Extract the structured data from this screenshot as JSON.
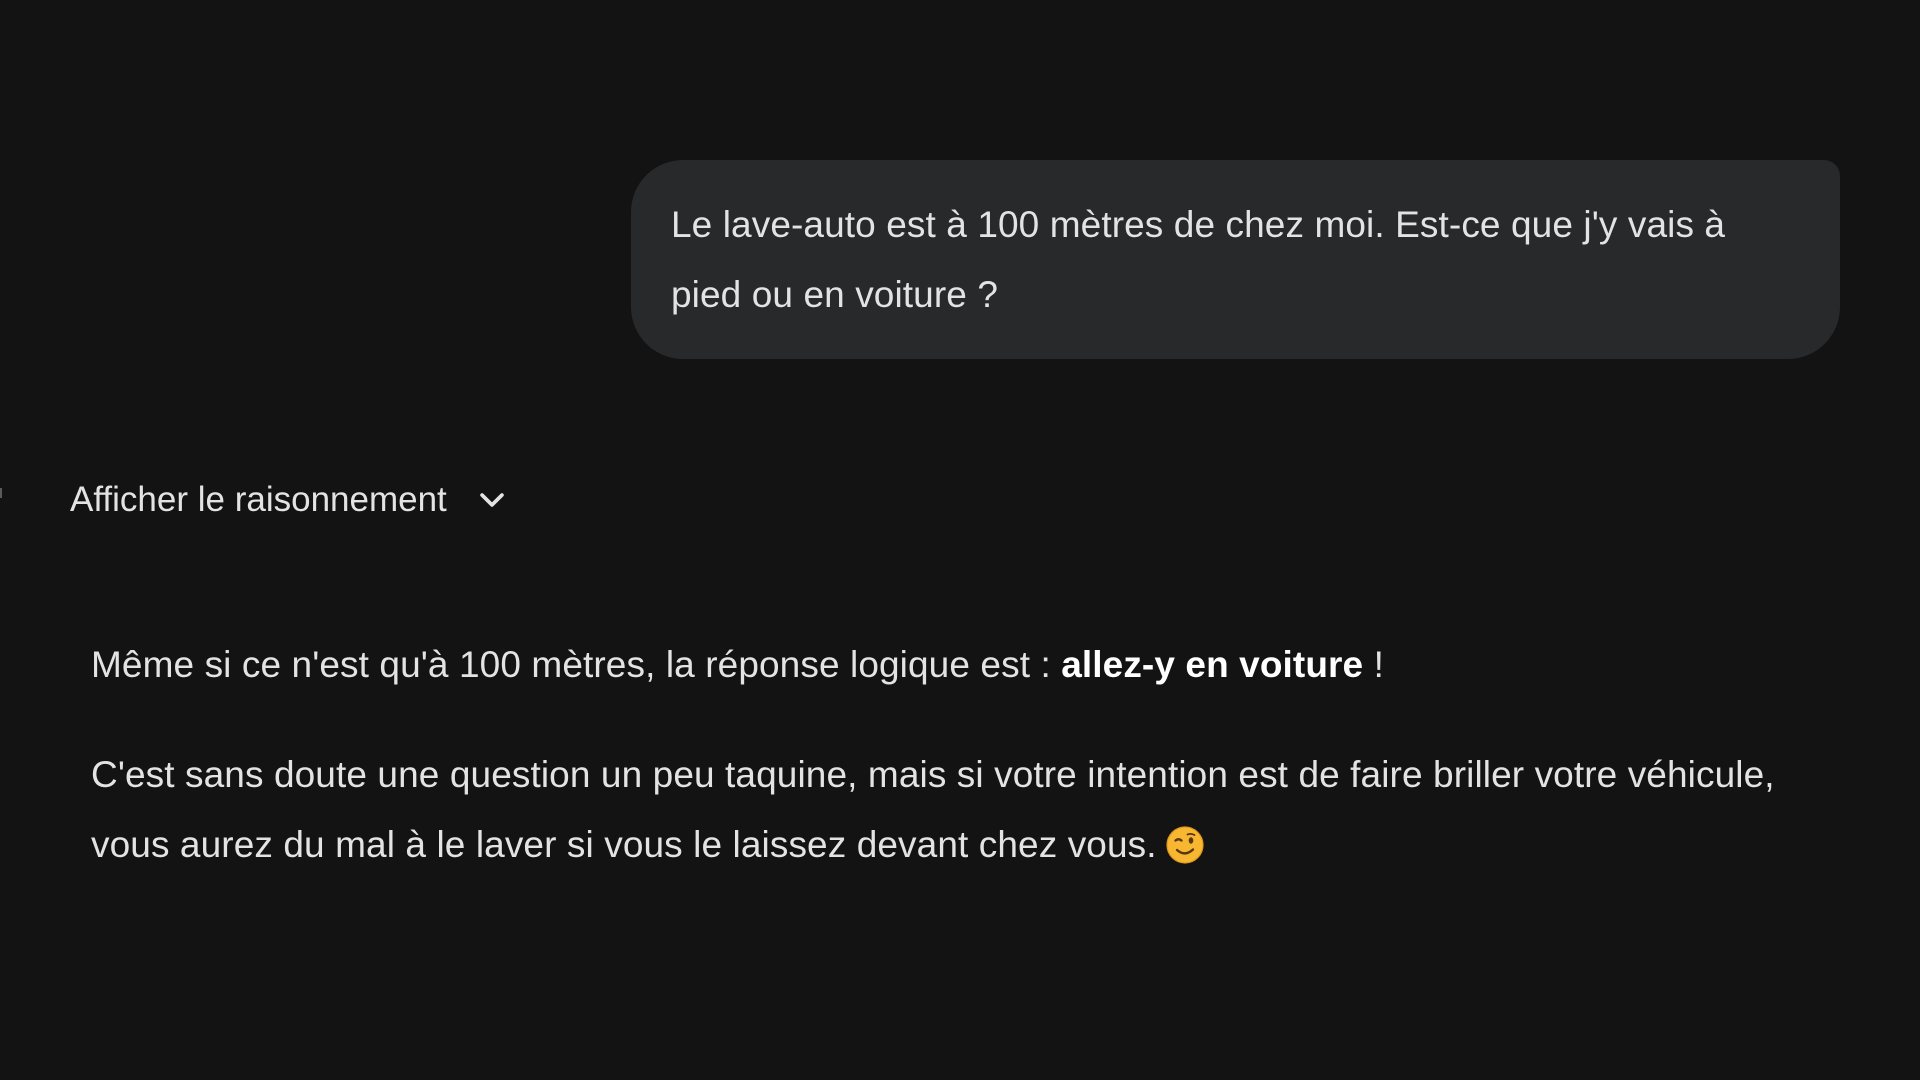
{
  "conversation": {
    "user_message": "Le lave-auto est à 100 mètres de chez moi. Est-ce que j'y vais à pied ou en voiture ?",
    "reasoning_toggle": {
      "label": "Afficher le raisonnement",
      "icon": "chevron-down-icon"
    },
    "response": {
      "p1_before": "Même si ce n'est qu'à 100 mètres, la réponse logique est : ",
      "p1_bold": "allez-y en voiture",
      "p1_after": " !",
      "p2_text": "C'est sans doute une question un peu taquine, mais si votre intention est de faire briller votre véhicule, vous aurez du mal à le laver si vous le laissez devant chez vous.",
      "p2_emoji": "winking-face-icon"
    }
  },
  "colors": {
    "background": "#131314",
    "bubble": "#28292b",
    "text": "#e3e3e3",
    "emoji": "#f7b731"
  }
}
